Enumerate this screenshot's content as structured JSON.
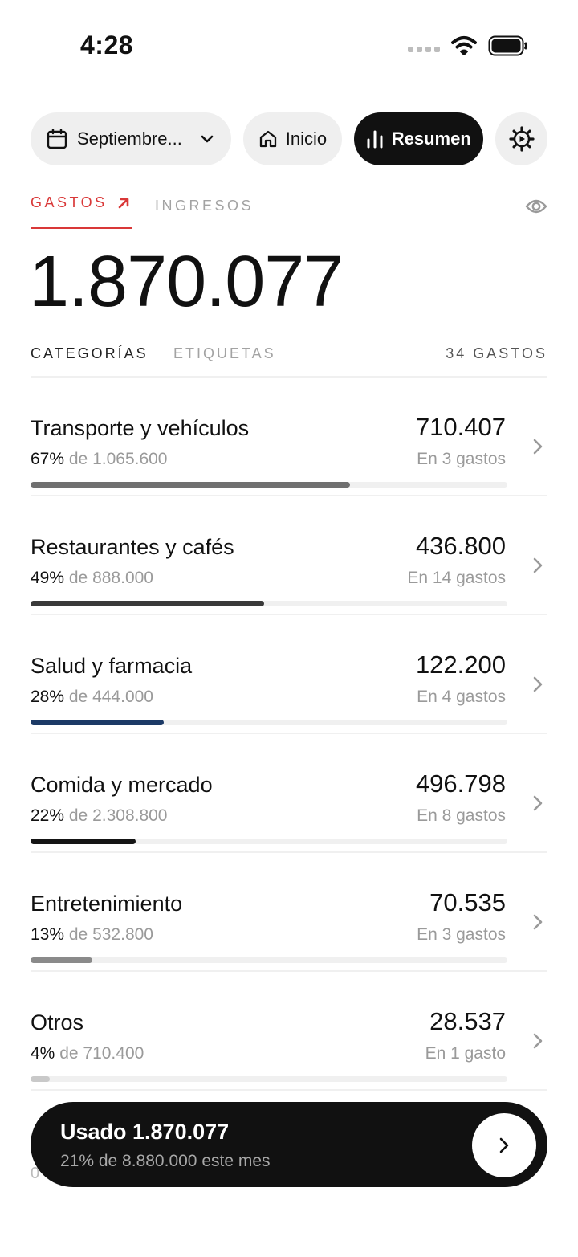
{
  "status": {
    "time": "4:28"
  },
  "toolbar": {
    "month_label": "Septiembre...",
    "home_label": "Inicio",
    "summary_label": "Resumen"
  },
  "tabs": {
    "expenses": "GASTOS",
    "income": "INGRESOS"
  },
  "total": "1.870.077",
  "subtabs": {
    "categories": "CATEGORÍAS",
    "tags": "ETIQUETAS",
    "count": "34 GASTOS"
  },
  "categories": [
    {
      "name": "Transporte y vehículos",
      "amount": "710.407",
      "pct": "67%",
      "of": "de 1.065.600",
      "count": "En 3 gastos",
      "fill_pct": 67,
      "color": "#707070"
    },
    {
      "name": "Restaurantes y cafés",
      "amount": "436.800",
      "pct": "49%",
      "of": "de 888.000",
      "count": "En 14 gastos",
      "fill_pct": 49,
      "color": "#3a3a3a"
    },
    {
      "name": "Salud y farmacia",
      "amount": "122.200",
      "pct": "28%",
      "of": "de 444.000",
      "count": "En 4 gastos",
      "fill_pct": 28,
      "color": "#1c3a66"
    },
    {
      "name": "Comida y mercado",
      "amount": "496.798",
      "pct": "22%",
      "of": "de 2.308.800",
      "count": "En 8 gastos",
      "fill_pct": 22,
      "color": "#151515"
    },
    {
      "name": "Entretenimiento",
      "amount": "70.535",
      "pct": "13%",
      "of": "de 532.800",
      "count": "En 3 gastos",
      "fill_pct": 13,
      "color": "#8a8a8a"
    },
    {
      "name": "Otros",
      "amount": "28.537",
      "pct": "4%",
      "of": "de 710.400",
      "count": "En 1 gasto",
      "fill_pct": 4,
      "color": "#c9c9c9"
    }
  ],
  "partial_text": "0",
  "footer": {
    "title": "Usado 1.870.077",
    "subtitle": "21% de 8.880.000 este mes"
  },
  "colors": {
    "accent": "#d93838",
    "dark": "#111111"
  }
}
